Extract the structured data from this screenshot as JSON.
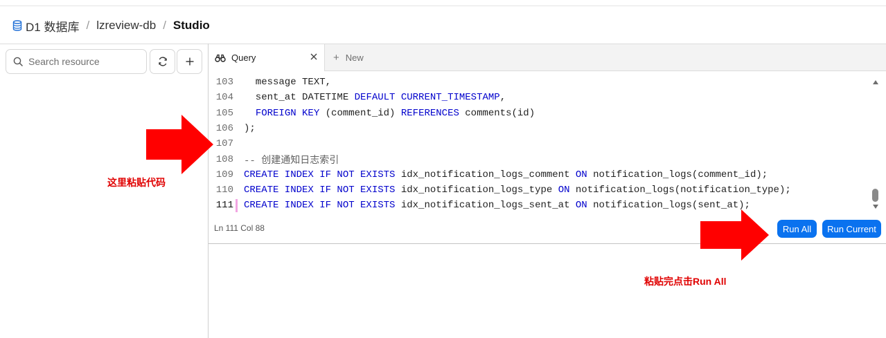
{
  "breadcrumb": {
    "items": [
      {
        "label": "D1 数据库"
      },
      {
        "label": "lzreview-db"
      },
      {
        "label": "Studio"
      }
    ],
    "separator": "/"
  },
  "sidebar": {
    "search_placeholder": "Search resource",
    "refresh_icon": "refresh-icon",
    "add_icon": "plus-icon"
  },
  "tabs": {
    "active_label": "Query",
    "new_label": "New"
  },
  "editor": {
    "lines": [
      {
        "number": "103",
        "tokens": [
          {
            "t": "  message TEXT,",
            "c": ""
          }
        ]
      },
      {
        "number": "104",
        "tokens": [
          {
            "t": "  sent_at DATETIME ",
            "c": ""
          },
          {
            "t": "DEFAULT CURRENT_TIMESTAMP",
            "c": "kw"
          },
          {
            "t": ",",
            "c": ""
          }
        ]
      },
      {
        "number": "105",
        "tokens": [
          {
            "t": "  ",
            "c": ""
          },
          {
            "t": "FOREIGN KEY",
            "c": "kw"
          },
          {
            "t": " (comment_id) ",
            "c": ""
          },
          {
            "t": "REFERENCES",
            "c": "kw"
          },
          {
            "t": " comments(id)",
            "c": ""
          }
        ]
      },
      {
        "number": "106",
        "tokens": [
          {
            "t": ");",
            "c": ""
          }
        ]
      },
      {
        "number": "107",
        "tokens": []
      },
      {
        "number": "108",
        "tokens": [
          {
            "t": "-- 创建通知日志索引",
            "c": "cm"
          }
        ]
      },
      {
        "number": "109",
        "tokens": [
          {
            "t": "CREATE INDEX IF NOT EXISTS",
            "c": "kw"
          },
          {
            "t": " idx_notification_logs_comment ",
            "c": ""
          },
          {
            "t": "ON",
            "c": "kw"
          },
          {
            "t": " notification_logs(comment_id);",
            "c": ""
          }
        ]
      },
      {
        "number": "110",
        "tokens": [
          {
            "t": "CREATE INDEX IF NOT EXISTS",
            "c": "kw"
          },
          {
            "t": " idx_notification_logs_type ",
            "c": ""
          },
          {
            "t": "ON",
            "c": "kw"
          },
          {
            "t": " notification_logs(notification_type);",
            "c": ""
          }
        ]
      },
      {
        "number": "111",
        "tokens": [
          {
            "t": "CREATE INDEX IF NOT EXISTS",
            "c": "kw"
          },
          {
            "t": " idx_notification_logs_sent_at ",
            "c": ""
          },
          {
            "t": "ON",
            "c": "kw"
          },
          {
            "t": " notification_logs(sent_at);",
            "c": ""
          }
        ]
      }
    ],
    "active_line": "111",
    "status": "Ln 111 Col 88"
  },
  "actions": {
    "run_all_label": "Run All",
    "run_current_label": "Run Current"
  },
  "annotations": {
    "paste_hint": "这里粘贴代码",
    "run_hint": "粘贴完点击Run All",
    "color": "#e00000"
  },
  "colors": {
    "accent": "#0a72ef",
    "keyword": "#0000cc",
    "comment": "#616161"
  }
}
